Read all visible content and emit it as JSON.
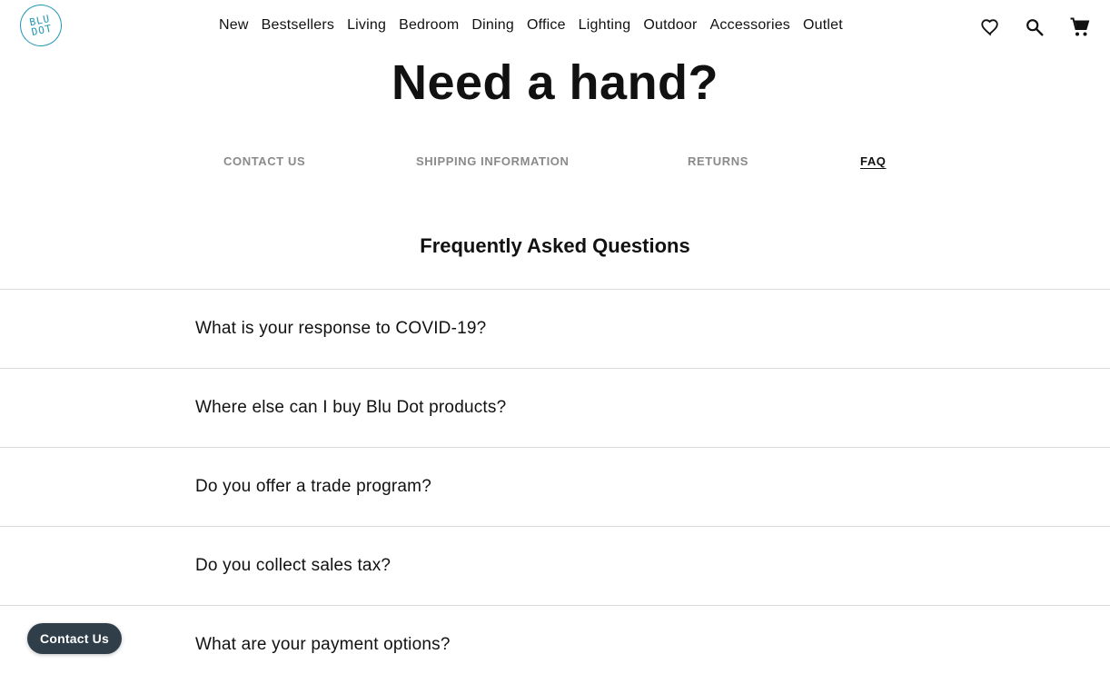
{
  "header": {
    "logo": {
      "line1": "BLU",
      "line2": "DOT"
    },
    "nav": [
      "New",
      "Bestsellers",
      "Living",
      "Bedroom",
      "Dining",
      "Office",
      "Lighting",
      "Outdoor",
      "Accessories",
      "Outlet"
    ],
    "icons": [
      "heart-icon",
      "search-icon",
      "cart-icon"
    ]
  },
  "main": {
    "title": "Need a hand?",
    "tabs": [
      {
        "label": "CONTACT US",
        "active": false
      },
      {
        "label": "SHIPPING INFORMATION",
        "active": false
      },
      {
        "label": "RETURNS",
        "active": false
      },
      {
        "label": "FAQ",
        "active": true
      }
    ],
    "faq_heading": "Frequently Asked Questions",
    "faq_items": [
      "What is your response to COVID-19?",
      "Where else can I buy Blu Dot products?",
      "Do you offer a trade program?",
      "Do you collect sales tax?",
      "What are your payment options?"
    ]
  },
  "floating": {
    "contact_label": "Contact Us"
  },
  "colors": {
    "brand": "#2196b6",
    "tab_inactive": "#8a8a8a",
    "divider": "#d9d9d9",
    "contact_button": "#2f3e49"
  }
}
